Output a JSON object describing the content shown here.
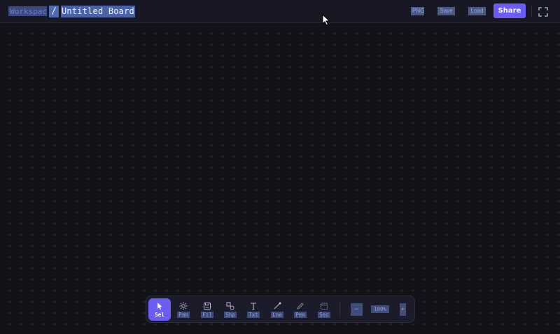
{
  "header": {
    "workspace": "Workspace",
    "separator": "/",
    "board_title": "Untitled Board",
    "actions": [
      {
        "label": "PNG"
      },
      {
        "label": "Save"
      },
      {
        "label": "Load"
      }
    ],
    "share_label": "Share"
  },
  "toolbar": {
    "tools": [
      {
        "label": "Sel",
        "icon": "pointer-icon",
        "active": true
      },
      {
        "label": "Pan",
        "icon": "pan-icon",
        "active": false
      },
      {
        "label": "Fil",
        "icon": "frame-icon",
        "active": false
      },
      {
        "label": "Shp",
        "icon": "shapes-icon",
        "active": false
      },
      {
        "label": "Txt",
        "icon": "text-icon",
        "active": false
      },
      {
        "label": "Lne",
        "icon": "line-icon",
        "active": false
      },
      {
        "label": "Pen",
        "icon": "pen-icon",
        "active": false
      },
      {
        "label": "Sec",
        "icon": "section-icon",
        "active": false
      }
    ],
    "zoom_out": "−",
    "zoom_value": "100%",
    "zoom_in": "+"
  },
  "colors": {
    "accent": "#6a5cf5",
    "background": "#121219",
    "topbar": "#181824"
  }
}
